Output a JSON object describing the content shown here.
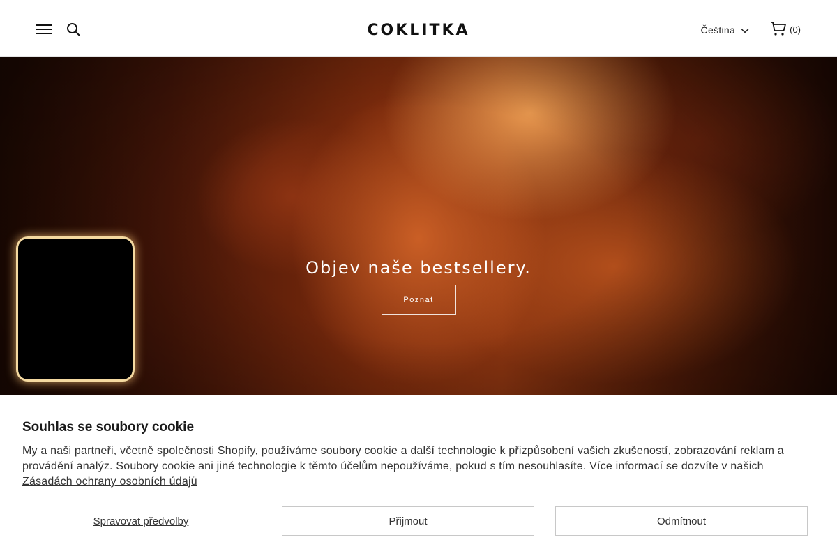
{
  "header": {
    "logo_text": "COKLITKA",
    "language_label": "Čeština",
    "cart_count": "(0)"
  },
  "hero": {
    "title": "Objev naše bestsellery.",
    "button_label": "Poznat"
  },
  "cookie": {
    "title": "Souhlas se soubory cookie",
    "text": "My a naši partneři, včetně společnosti Shopify, používáme soubory cookie a další technologie k přizpůsobení vašich zkušeností, zobrazování reklam a provádění analýz. Soubory cookie ani jiné technologie k těmto účelům nepoužíváme, pokud s tím nesouhlasíte. Více informací se dozvíte v našich ",
    "link_label": "Zásadách ochrany osobních údajů",
    "manage_label": "Spravovat předvolby",
    "accept_label": "Přijmout",
    "decline_label": "Odmítnout"
  },
  "icons": {
    "menu": "hamburger-menu-icon",
    "search": "search-icon",
    "chevron": "chevron-down-icon",
    "cart": "cart-icon"
  }
}
